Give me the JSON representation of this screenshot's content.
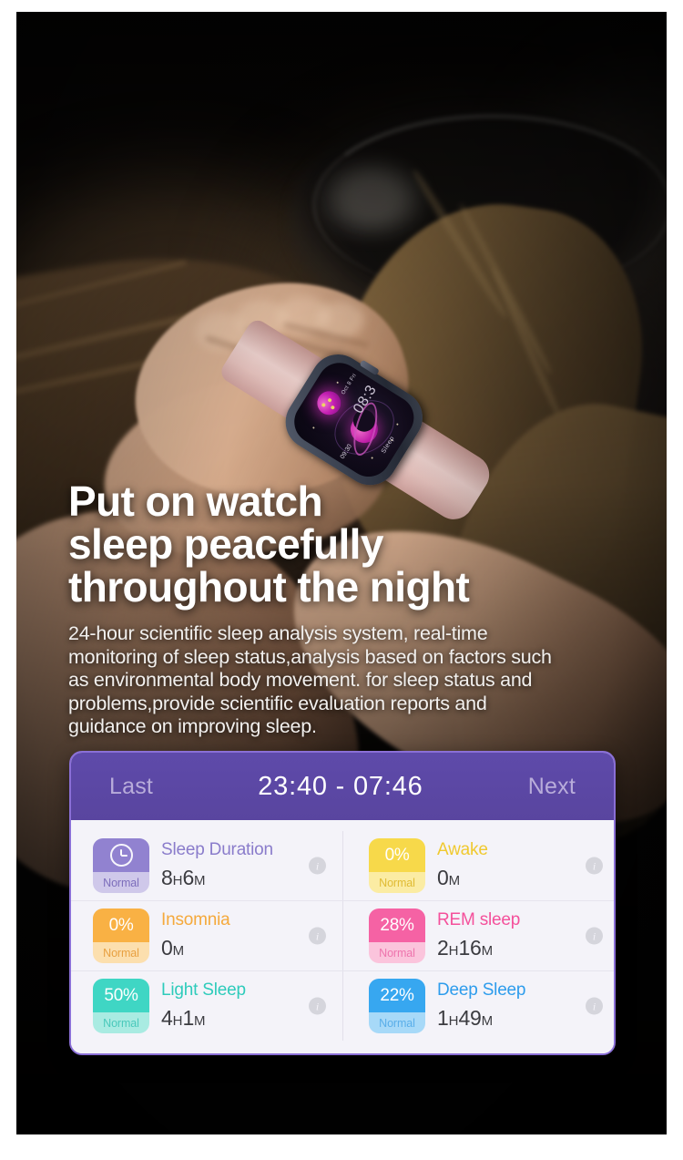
{
  "headline": {
    "line1": "Put on watch",
    "line2": "sleep peacefully",
    "line3": "throughout the night"
  },
  "subcopy": "24-hour scientific sleep analysis system, real-time monitoring of sleep status,analysis based on factors such as environmental body movement. for sleep status and problems,provide scientific evaluation reports and guidance on improving sleep.",
  "watch": {
    "time": "08:3",
    "date": "Oct 8 Fri",
    "left_label": "09:30",
    "sleep_label": "Sleep",
    "face_name": "moon-planet-sleep-face"
  },
  "card": {
    "header": {
      "prev_label": "Last",
      "date_range": "23:40 - 07:46",
      "next_label": "Next"
    },
    "info_glyph": "i",
    "metrics": [
      {
        "name": "sleep-duration",
        "badge": "",
        "badge_icon": "clock-icon",
        "status": "Normal",
        "label": "Sleep Duration",
        "value_num1": "8",
        "value_unit1": "H",
        "value_num2": "6",
        "value_unit2": "M",
        "color_top": "#9182d0",
        "color_bottom": "#cfc8ea",
        "label_color": "#8a7ccb",
        "status_color": "#7c6dbb"
      },
      {
        "name": "awake",
        "badge": "0%",
        "badge_icon": "",
        "status": "Normal",
        "label": "Awake",
        "value_num1": "0",
        "value_unit1": "M",
        "value_num2": "",
        "value_unit2": "",
        "color_top": "#f7d94a",
        "color_bottom": "#fbeca3",
        "label_color": "#f0c92f",
        "status_color": "#e8c43a"
      },
      {
        "name": "insomnia",
        "badge": "0%",
        "badge_icon": "",
        "status": "Normal",
        "label": "Insomnia",
        "value_num1": "0",
        "value_unit1": "M",
        "value_num2": "",
        "value_unit2": "",
        "color_top": "#f9b košt",
        "color_bottom": "#fcdfae",
        "label_color": "#f5a93c",
        "status_color": "#eda844"
      },
      {
        "name": "rem-sleep",
        "badge": "28%",
        "badge_icon": "",
        "status": "Normal",
        "label": "REM sleep",
        "value_num1": "2",
        "value_unit1": "H",
        "value_num2": "16",
        "value_unit2": "M",
        "color_top": "#f munkát",
        "color_bottom": "#fbc4dc",
        "label_color": "#f4509b",
        "status_color": "#f06aa8"
      },
      {
        "name": "light-sleep",
        "badge": "50%",
        "badge_icon": "",
        "status": "Normal",
        "label": "Light Sleep",
        "value_num1": "4",
        "value_unit1": "H",
        "value_num2": "1",
        "value_unit2": "M",
        "color_top": "#3fd6c4",
        "color_bottom": "#a9ebe2",
        "label_color": "#2ecbbb",
        "status_color": "#46c8bb"
      },
      {
        "name": "deep-sleep",
        "badge": "22%",
        "badge_icon": "",
        "status": "Normal",
        "label": "Deep Sleep",
        "value_num1": "1",
        "value_unit1": "H",
        "value_num2": "49",
        "value_unit2": "M",
        "color_top": "#37a7f0",
        "color_bottom": "#a7d9f8",
        "label_color": "#2d9cec",
        "status_color": "#4fa9e8"
      }
    ]
  },
  "colors": {
    "header_purple": "#5b46a8",
    "card_border": "#8a6fd6",
    "card_bg": "#f4f3f9"
  }
}
